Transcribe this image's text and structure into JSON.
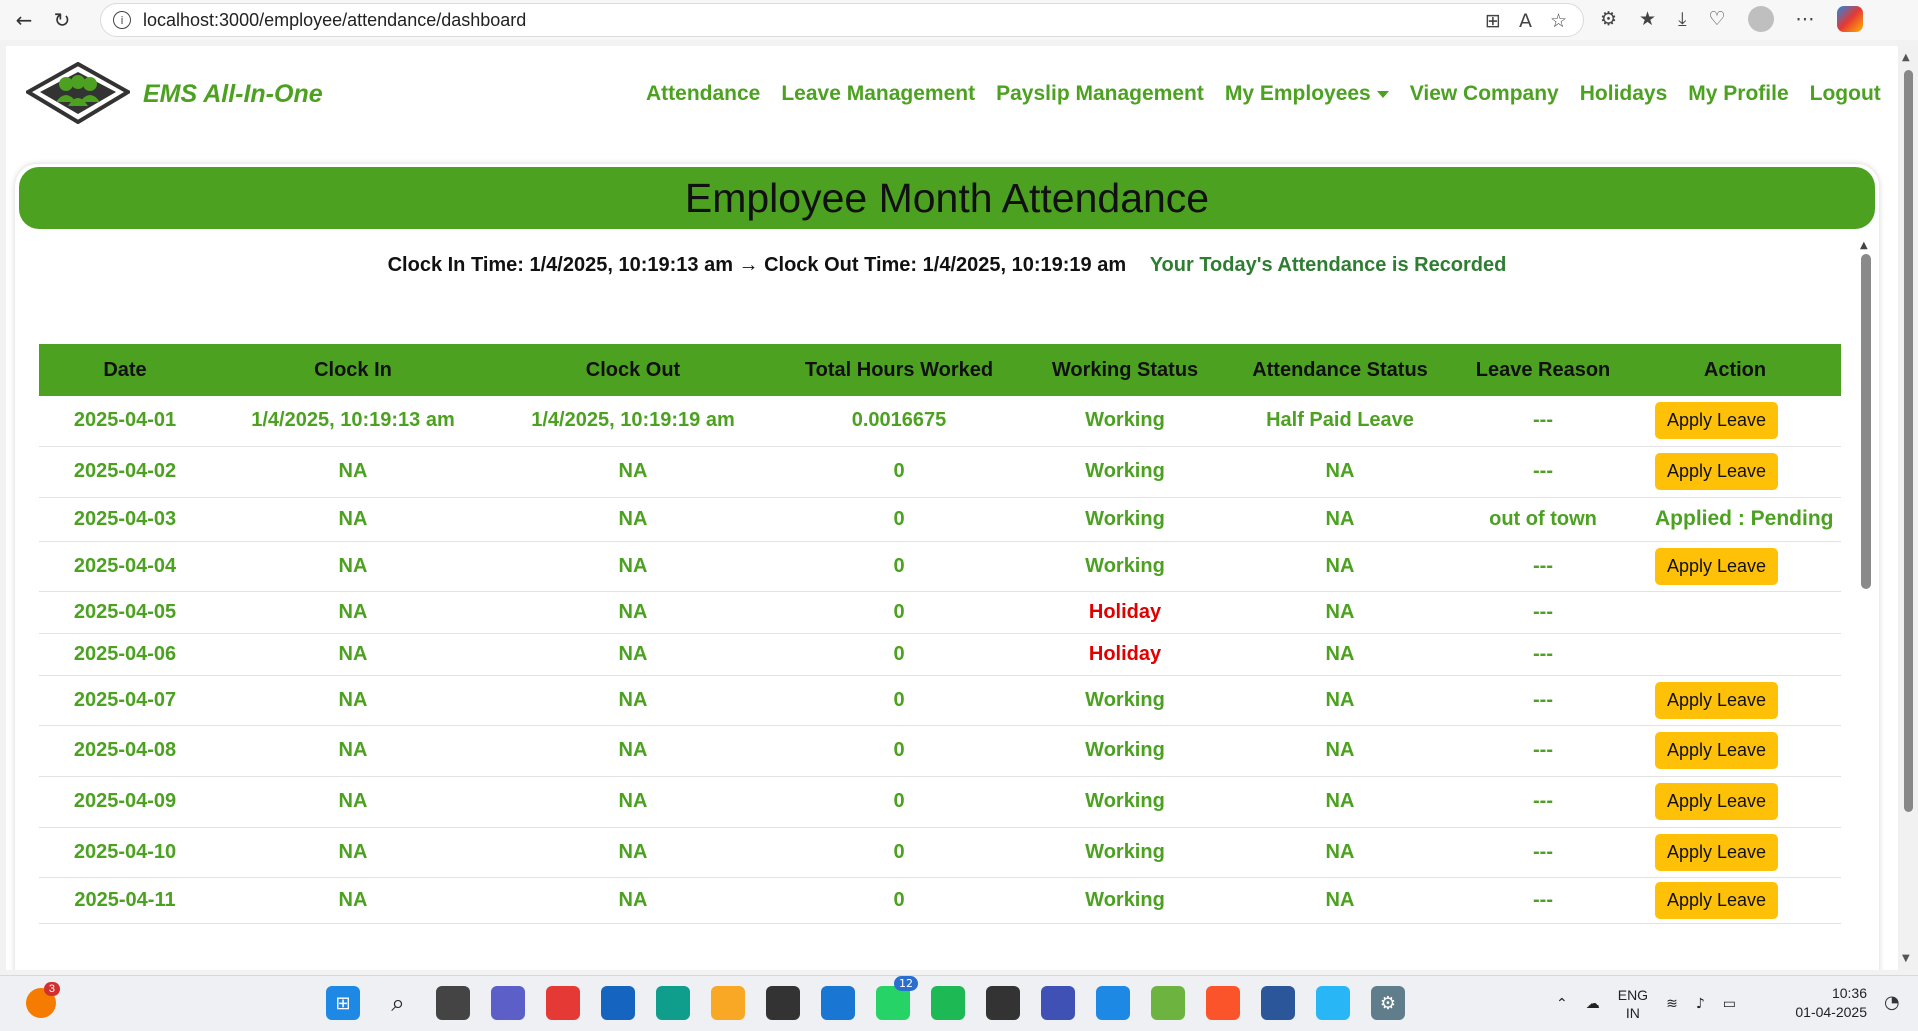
{
  "browser": {
    "url": "localhost:3000/employee/attendance/dashboard"
  },
  "app": {
    "brand": "EMS All-In-One",
    "menu": [
      "Attendance",
      "Leave Management",
      "Payslip Management",
      "My Employees",
      "View Company",
      "Holidays",
      "My Profile",
      "Logout"
    ]
  },
  "page": {
    "title": "Employee Month Attendance",
    "clock_text": "Clock In Time: 1/4/2025, 10:19:13 am → Clock Out Time: 1/4/2025, 10:19:19 am",
    "recorded_text": "Your Today's Attendance is Recorded"
  },
  "table": {
    "headers": [
      "Date",
      "Clock In",
      "Clock Out",
      "Total Hours Worked",
      "Working Status",
      "Attendance Status",
      "Leave Reason",
      "Action"
    ],
    "rows": [
      {
        "date": "2025-04-01",
        "in": "1/4/2025, 10:19:13 am",
        "out": "1/4/2025, 10:19:19 am",
        "hours": "0.0016675",
        "status": "Working",
        "att": "Half Paid Leave",
        "reason": "---",
        "action": "Apply Leave",
        "action_type": "button"
      },
      {
        "date": "2025-04-02",
        "in": "NA",
        "out": "NA",
        "hours": "0",
        "status": "Working",
        "att": "NA",
        "reason": "---",
        "action": "Apply Leave",
        "action_type": "button"
      },
      {
        "date": "2025-04-03",
        "in": "NA",
        "out": "NA",
        "hours": "0",
        "status": "Working",
        "att": "NA",
        "reason": "out of town",
        "action": "Applied : Pending",
        "action_type": "text"
      },
      {
        "date": "2025-04-04",
        "in": "NA",
        "out": "NA",
        "hours": "0",
        "status": "Working",
        "att": "NA",
        "reason": "---",
        "action": "Apply Leave",
        "action_type": "button"
      },
      {
        "date": "2025-04-05",
        "in": "NA",
        "out": "NA",
        "hours": "0",
        "status": "Holiday",
        "att": "NA",
        "reason": "---",
        "action": "",
        "action_type": "none"
      },
      {
        "date": "2025-04-06",
        "in": "NA",
        "out": "NA",
        "hours": "0",
        "status": "Holiday",
        "att": "NA",
        "reason": "---",
        "action": "",
        "action_type": "none"
      },
      {
        "date": "2025-04-07",
        "in": "NA",
        "out": "NA",
        "hours": "0",
        "status": "Working",
        "att": "NA",
        "reason": "---",
        "action": "Apply Leave",
        "action_type": "button"
      },
      {
        "date": "2025-04-08",
        "in": "NA",
        "out": "NA",
        "hours": "0",
        "status": "Working",
        "att": "NA",
        "reason": "---",
        "action": "Apply Leave",
        "action_type": "button"
      },
      {
        "date": "2025-04-09",
        "in": "NA",
        "out": "NA",
        "hours": "0",
        "status": "Working",
        "att": "NA",
        "reason": "---",
        "action": "Apply Leave",
        "action_type": "button"
      },
      {
        "date": "2025-04-10",
        "in": "NA",
        "out": "NA",
        "hours": "0",
        "status": "Working",
        "att": "NA",
        "reason": "---",
        "action": "Apply Leave",
        "action_type": "button"
      },
      {
        "date": "2025-04-11",
        "in": "NA",
        "out": "NA",
        "hours": "0",
        "status": "Working",
        "att": "NA",
        "reason": "---",
        "action": "Apply Leave",
        "action_type": "button"
      }
    ]
  },
  "colors": {
    "accent": "#4ca121",
    "holiday": "#e00000",
    "button": "#ffc107"
  },
  "taskbar": {
    "weather_badge": "3",
    "whatsapp_badge": "12",
    "lang_top": "ENG",
    "lang_bottom": "IN",
    "time": "10:36",
    "date": "01-04-2025",
    "icons": [
      "start-icon",
      "search-icon",
      "task-view-icon",
      "teams-icon",
      "copilot-icon",
      "vs-icon",
      "edge-icon",
      "file-explorer-icon",
      "unity-icon",
      "store-icon",
      "whatsapp-icon",
      "spotify-icon",
      "terminal-icon",
      "visual-studio-icon",
      "vscode-icon",
      "springboot-icon",
      "brave-icon",
      "word-icon",
      "paint-icon",
      "settings-icon"
    ]
  }
}
